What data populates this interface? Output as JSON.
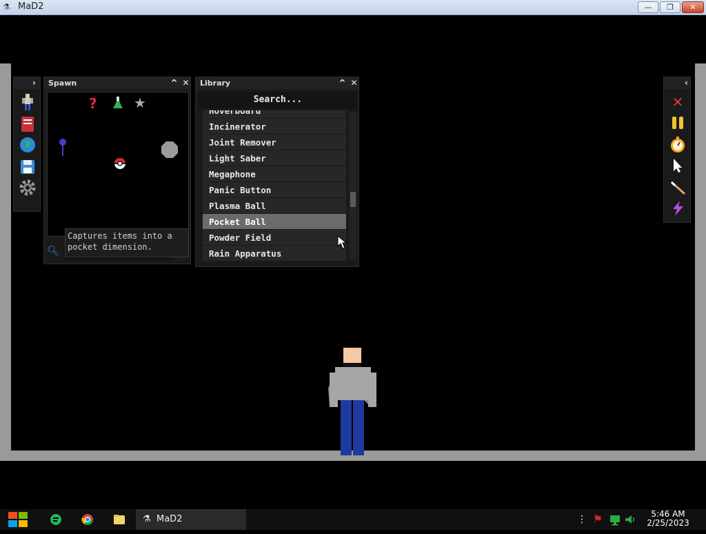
{
  "window": {
    "title": "MaD2",
    "minimize": "—",
    "restore": "❐",
    "close": "✕"
  },
  "left_toolbar": {
    "collapse": "›",
    "icons": [
      "figure-icon",
      "book-icon",
      "globe-icon",
      "save-icon",
      "gear-icon"
    ]
  },
  "spawn": {
    "title": "Spawn",
    "minimize": "^",
    "close": "✕",
    "selected_name": "Pocket Ball",
    "tooltip": "Captures items into a pocket dimension."
  },
  "library": {
    "title": "Library",
    "minimize": "^",
    "close": "✕",
    "search_placeholder": "Search...",
    "items": [
      {
        "label": "Hoverboard",
        "selected": false
      },
      {
        "label": "Incinerator",
        "selected": false
      },
      {
        "label": "Joint Remover",
        "selected": false
      },
      {
        "label": "Light Saber",
        "selected": false
      },
      {
        "label": "Megaphone",
        "selected": false
      },
      {
        "label": "Panic Button",
        "selected": false
      },
      {
        "label": "Plasma Ball",
        "selected": false
      },
      {
        "label": "Pocket Ball",
        "selected": true
      },
      {
        "label": "Powder Field",
        "selected": false
      },
      {
        "label": "Rain Apparatus",
        "selected": false
      }
    ]
  },
  "right_toolbar": {
    "collapse": "‹",
    "icons": [
      "delete-icon",
      "pause-icon",
      "stopwatch-icon",
      "pointer-icon",
      "wand-icon",
      "lightning-icon"
    ]
  },
  "taskbar": {
    "task_label": "MaD2",
    "time": "5:46 AM",
    "date": "2/25/2023"
  }
}
